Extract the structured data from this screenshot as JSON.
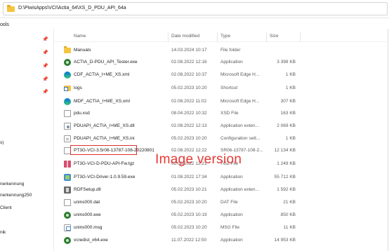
{
  "address": {
    "path": "D:\\PiwisApps\\VCI\\Actia_64\\XS_D_PDU_API_64a"
  },
  "toolbar": {
    "tools_label": "ools"
  },
  "sidebar": {
    "labels": [
      "s)",
      "nerkennung",
      "nerkennung250",
      "Client",
      "nik"
    ]
  },
  "columns": {
    "name": "Name",
    "date": "Date modified",
    "type": "Type",
    "size": "Size"
  },
  "files": [
    {
      "name": "Manuals",
      "date": "14.03.2024 10:17",
      "type": "File folder",
      "size": "",
      "icon": "folder-icon"
    },
    {
      "name": "ACTIA_D-PDU_API_Tester.exe",
      "date": "02.08.2022 12:16",
      "type": "Application",
      "size": "3 398 KB",
      "icon": "exe-icon"
    },
    {
      "name": "CDF_ACTIA_I+ME_XS.xml",
      "date": "02.08.2022 10:37",
      "type": "Microsoft Edge H...",
      "size": "1 KB",
      "icon": "edge-icon"
    },
    {
      "name": "logs",
      "date": "05.02.2023 10:20",
      "type": "Shortcut",
      "size": "1 KB",
      "icon": "shortcut-icon"
    },
    {
      "name": "MDF_ACTIA_I+ME_XS.xml",
      "date": "02.08.2022 11:02",
      "type": "Microsoft Edge H...",
      "size": "307 KB",
      "icon": "edge-icon"
    },
    {
      "name": "pdu.xsd",
      "date": "08.04.2022 10:32",
      "type": "XSD File",
      "size": "163 KB",
      "icon": "xsd-icon"
    },
    {
      "name": "PDUAPI_ACTIA_I+ME_XS.dll",
      "date": "02.08.2022 12:13",
      "type": "Application exten...",
      "size": "2 069 KB",
      "icon": "dll-icon"
    },
    {
      "name": "PDUAPI_ACTIA_I+ME_XS.ini",
      "date": "05.02.2023 10:20",
      "type": "Configuration sett...",
      "size": "1 KB",
      "icon": "ini-icon"
    },
    {
      "name": "PT3G-VCI-3.5r06-13787-108-20220801",
      "date": "02.08.2022 12:22",
      "type": "SR06-13787-108-2...",
      "size": "12 134 KB",
      "icon": "sr6-icon",
      "highlight": true
    },
    {
      "name": "PT3G-VCI-D-PDU-API-Fw.tgz",
      "date": "02.08.2022 12:21",
      "type": "TGZ File",
      "size": "1 249 KB",
      "icon": "tgz-icon"
    },
    {
      "name": "PT3G-VCI-Driver-1.0.9.59.exe",
      "date": "01.08.2022 17:34",
      "type": "Application",
      "size": "55 712 KB",
      "icon": "package-icon"
    },
    {
      "name": "RDFSetup.dll",
      "date": "05.02.2023 10:21",
      "type": "Application exten...",
      "size": "1 592 KB",
      "icon": "rdf-icon"
    },
    {
      "name": "unins000.dat",
      "date": "05.02.2023 10:20",
      "type": "DAT File",
      "size": "21 KB",
      "icon": "dat-icon"
    },
    {
      "name": "unins000.exe",
      "date": "05.02.2023 10:19",
      "type": "Application",
      "size": "850 KB",
      "icon": "exe-icon"
    },
    {
      "name": "unins000.msg",
      "date": "05.02.2023 10:20",
      "type": "MSG File",
      "size": "11 KB",
      "icon": "msg-icon"
    },
    {
      "name": "vcredist_x64.exe",
      "date": "11.07.2022 12:50",
      "type": "Application",
      "size": "14 953 KB",
      "icon": "exe-icon"
    }
  ],
  "watermark": {
    "text": "Image version",
    "color": "#e53935"
  }
}
